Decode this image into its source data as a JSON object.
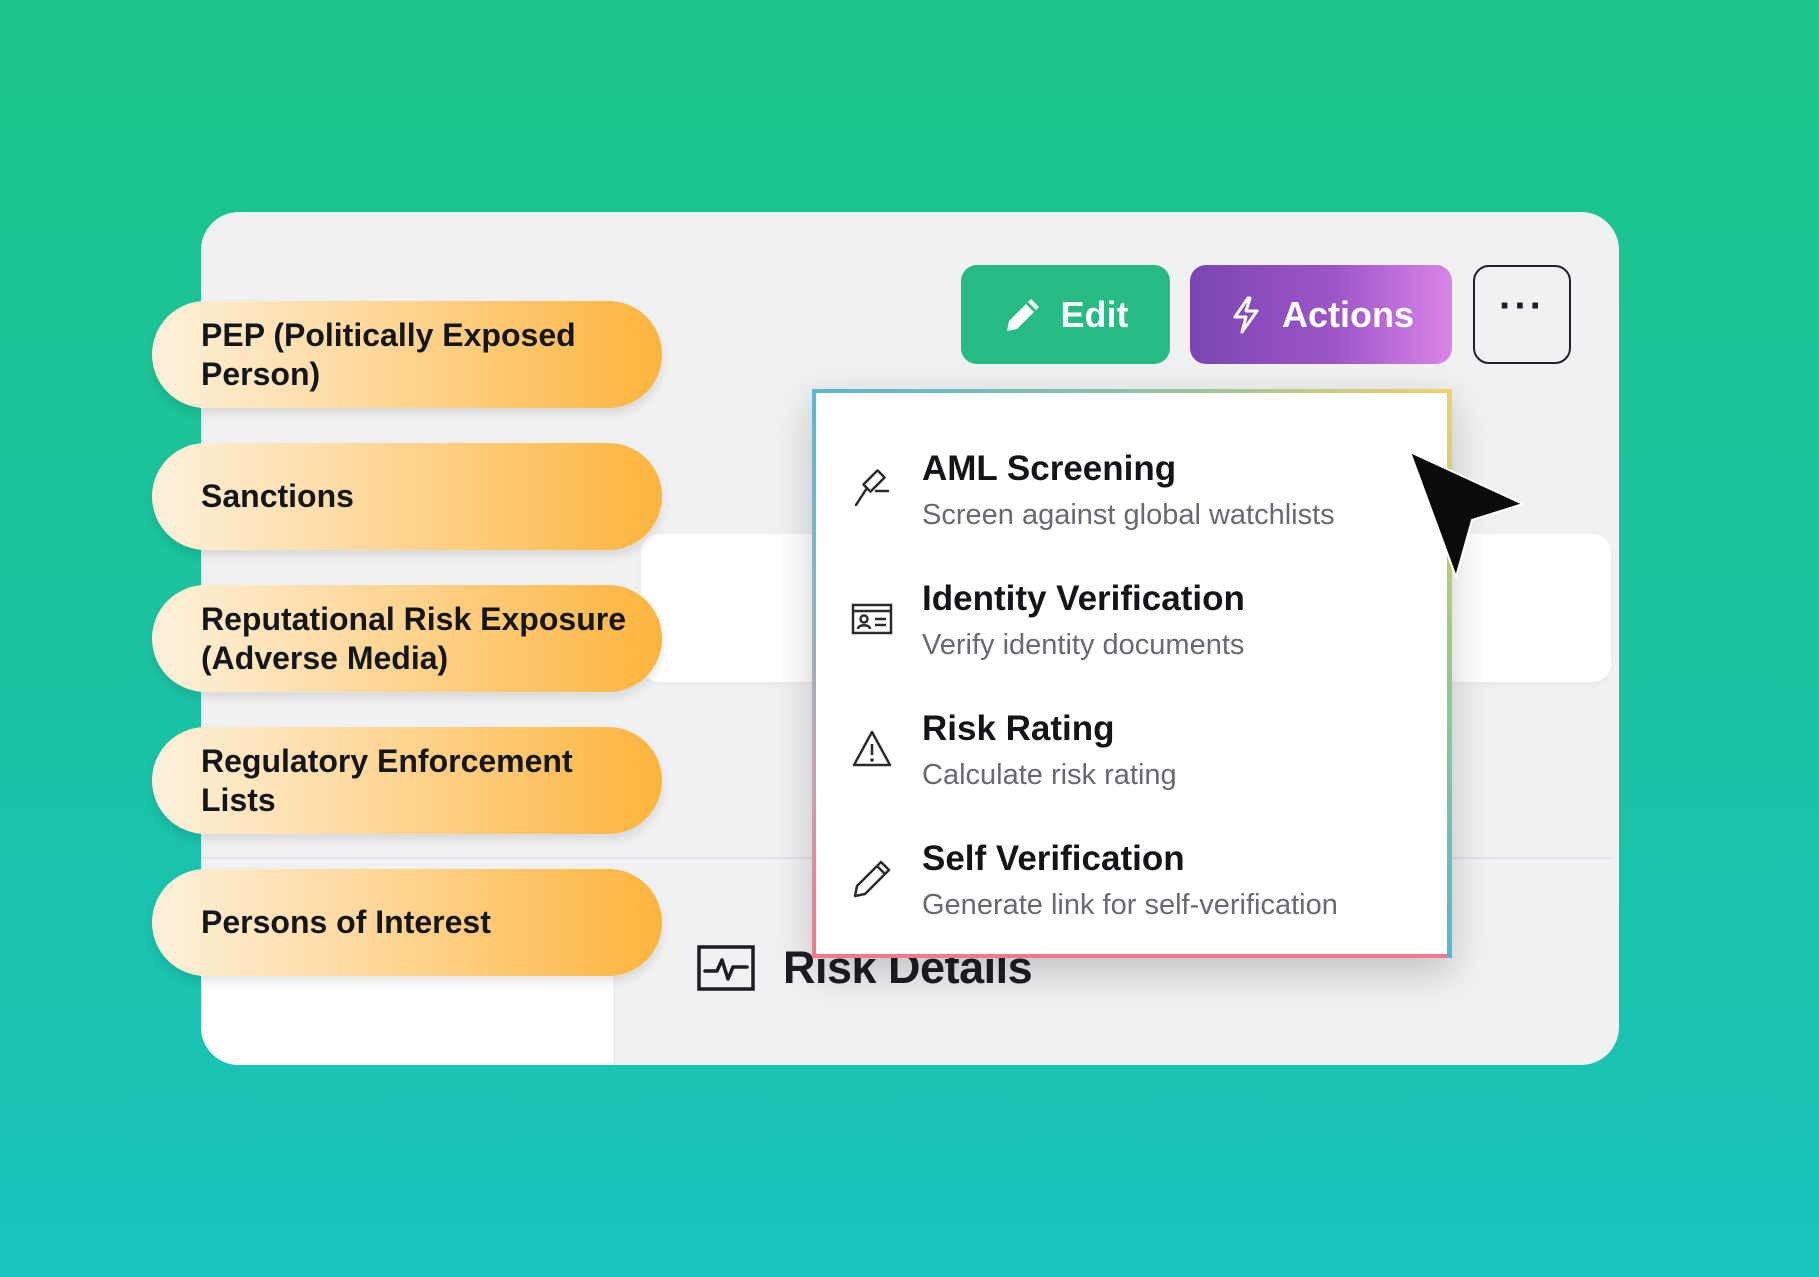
{
  "toolbar": {
    "edit_label": "Edit",
    "actions_label": "Actions",
    "more_label": "···"
  },
  "risk_categories": [
    {
      "line1": "PEP (Politically Exposed",
      "line2": "Person)"
    },
    {
      "line1": "Sanctions",
      "line2": ""
    },
    {
      "line1": "Reputational Risk Exposure",
      "line2": "(Adverse Media)"
    },
    {
      "line1": "Regulatory Enforcement",
      "line2": "Lists"
    },
    {
      "line1": "Persons of Interest",
      "line2": ""
    }
  ],
  "actions_menu": {
    "items": [
      {
        "title": "AML Screening",
        "description": "Screen against global watchlists",
        "icon": "gavel-icon"
      },
      {
        "title": "Identity Verification",
        "description": "Verify identity documents",
        "icon": "id-card-icon"
      },
      {
        "title": "Risk Rating",
        "description": "Calculate risk rating",
        "icon": "warning-icon"
      },
      {
        "title": "Self Verification",
        "description": "Generate link for self-verification",
        "icon": "pencil-icon"
      }
    ]
  },
  "section": {
    "title": "Risk Details",
    "icon": "activity-chart-icon"
  },
  "colors": {
    "edit_button": "#25bb83",
    "actions_gradient_start": "#7b45b3",
    "actions_gradient_end": "#d985e8",
    "pill_accent": "#fdb43c",
    "background_top": "#1dc58a",
    "background_bottom": "#18c4bd"
  }
}
